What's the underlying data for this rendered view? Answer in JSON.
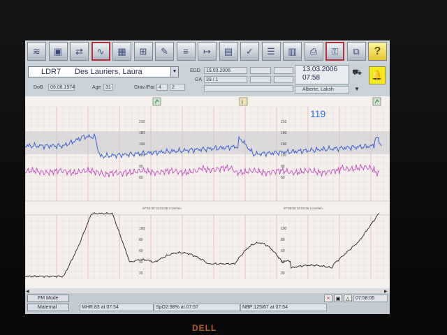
{
  "toolbar": {
    "buttons": [
      {
        "name": "waves-tool",
        "glyph": "≋",
        "active": false
      },
      {
        "name": "monitor-tool",
        "glyph": "▣",
        "active": false
      },
      {
        "name": "transfer-tool",
        "glyph": "⇄",
        "active": false
      },
      {
        "name": "trace-view-tool",
        "glyph": "∿",
        "active": true
      },
      {
        "name": "grid-chart-tool",
        "glyph": "▦",
        "active": false
      },
      {
        "name": "overview-tool",
        "glyph": "⊞",
        "active": false
      },
      {
        "name": "edit-tool",
        "glyph": "✎",
        "active": false
      },
      {
        "name": "notes-tool",
        "glyph": "≡",
        "active": false
      },
      {
        "name": "history-tool",
        "glyph": "↦",
        "active": false
      },
      {
        "name": "folder-tool",
        "glyph": "▤",
        "active": false
      },
      {
        "name": "check-tool",
        "glyph": "✓",
        "active": false
      },
      {
        "name": "list-tool",
        "glyph": "☰",
        "active": false
      },
      {
        "name": "layout-tool",
        "glyph": "▥",
        "active": false
      },
      {
        "name": "print-tool",
        "glyph": "⎙",
        "active": false
      },
      {
        "name": "lock-tool",
        "glyph": "⚿",
        "active": true
      },
      {
        "name": "network-tool",
        "glyph": "⧉",
        "active": false
      },
      {
        "name": "help-tool",
        "glyph": "?",
        "active": false
      }
    ]
  },
  "patient": {
    "bed": "LDR7",
    "name": "Des Lauriers, Laura",
    "dob_label": "DoB",
    "dob": "09.08.1974",
    "age_label": "Age",
    "age": "31",
    "gravpar_label": "Grav./Par.",
    "grav": "4",
    "par": "2",
    "edd_label": "EDD",
    "edd": "19.03.2006",
    "ga_label": "GA",
    "ga": "39 / 1"
  },
  "session": {
    "date": "13.03.2006",
    "time": "07:58",
    "user": "Alberte, Laksh"
  },
  "icons": {
    "side": "monitor-cart-icon",
    "alarm": "bell-icon",
    "expand": "down-arrow-icon"
  },
  "trace": {
    "fhr_value": "119",
    "fhr_color": "#2b6fd6",
    "upper_scale": [
      "210",
      "180",
      "150",
      "120",
      "90",
      "60"
    ],
    "lower_scale": [
      "100",
      "80",
      "60",
      "40",
      "20"
    ],
    "annotation_1": "07:52:30 13.03.06  2 cm/min",
    "annotation_2": "07:55:00 13.03.06  2 cm/min",
    "fhr_trace_color": "#3a62d2",
    "mhr_trace_color": "#c34cc4",
    "toco_trace_color": "#222222"
  },
  "status": {
    "fm_mode": "FM Mode",
    "maternal": "Maternal",
    "mhr": "MHR:83 at 07:54",
    "spo2": "SpO2:98% at 07:57",
    "nbp": "NBP:125/67 at 07:54",
    "clock": "07:58:05"
  }
}
